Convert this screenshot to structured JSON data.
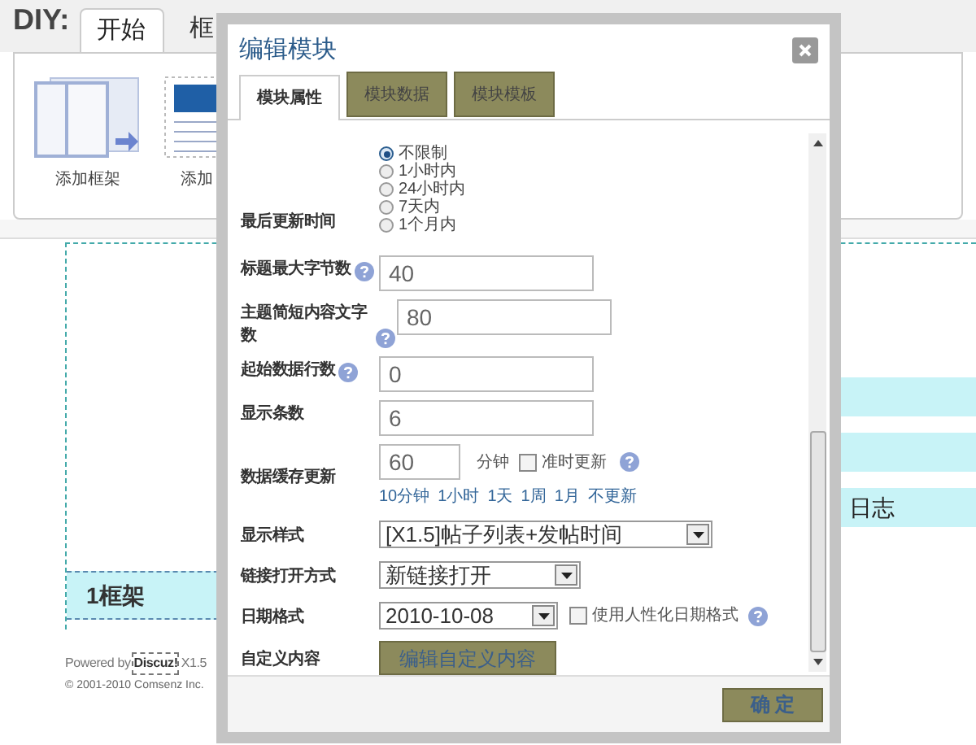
{
  "page": {
    "diy_label": "DIY:",
    "tabs": [
      {
        "label": "开始",
        "selected": true
      },
      {
        "label": "框",
        "selected": false
      }
    ],
    "toolbar_items": [
      {
        "kind": "frame",
        "label": "添加框架"
      },
      {
        "kind": "module",
        "label": "添加"
      }
    ],
    "side_bands": [
      {
        "kind": "blank"
      },
      {
        "kind": "blank"
      },
      {
        "kind": "titled",
        "text": "日志"
      }
    ],
    "frame_title": "1框架",
    "footer": {
      "powered": "Powered by",
      "brand": "Discuz!",
      "version": "X1.5",
      "copyright": "© 2001-2010 Comsenz Inc."
    }
  },
  "dialog": {
    "title": "编辑模块",
    "tabs": [
      {
        "label": "模块属性",
        "selected": true
      },
      {
        "label": "模块数据",
        "selected": false
      },
      {
        "label": "模块模板",
        "selected": false
      }
    ],
    "fields": [
      {
        "kind": "radio",
        "label": "最后更新时间",
        "options": [
          {
            "label": "不限制",
            "selected": true
          },
          {
            "label": "1小时内",
            "selected": false
          },
          {
            "label": "24小时内",
            "selected": false
          },
          {
            "label": "7天内",
            "selected": false
          },
          {
            "label": "1个月内",
            "selected": false
          }
        ]
      },
      {
        "kind": "text",
        "label": "标题最大字节数",
        "help": true,
        "value": "40"
      },
      {
        "kind": "text",
        "label": "主题简短内容文字数",
        "help": true,
        "value": "80"
      },
      {
        "kind": "text",
        "label": "起始数据行数",
        "help": true,
        "value": "0"
      },
      {
        "kind": "text",
        "label": "显示条数",
        "value": "6"
      },
      {
        "kind": "cache",
        "label": "数据缓存更新",
        "value": "60",
        "unit": "分钟",
        "checkbox": {
          "label": "准时更新",
          "checked": false
        },
        "help": true,
        "links": [
          "10分钟",
          "1小时",
          "1天",
          "1周",
          "1月",
          "不更新"
        ]
      },
      {
        "kind": "select",
        "label": "显示样式",
        "value": "[X1.5]帖子列表+发帖时间"
      },
      {
        "kind": "select",
        "label": "链接打开方式",
        "value": "新链接打开"
      },
      {
        "kind": "date",
        "label": "日期格式",
        "value": "2010-10-08",
        "checkbox": {
          "label": "使用人性化日期格式",
          "checked": false
        },
        "help": true
      },
      {
        "kind": "button",
        "label": "自定义内容",
        "button": "编辑自定义内容"
      }
    ],
    "ok_button": "确 定"
  }
}
